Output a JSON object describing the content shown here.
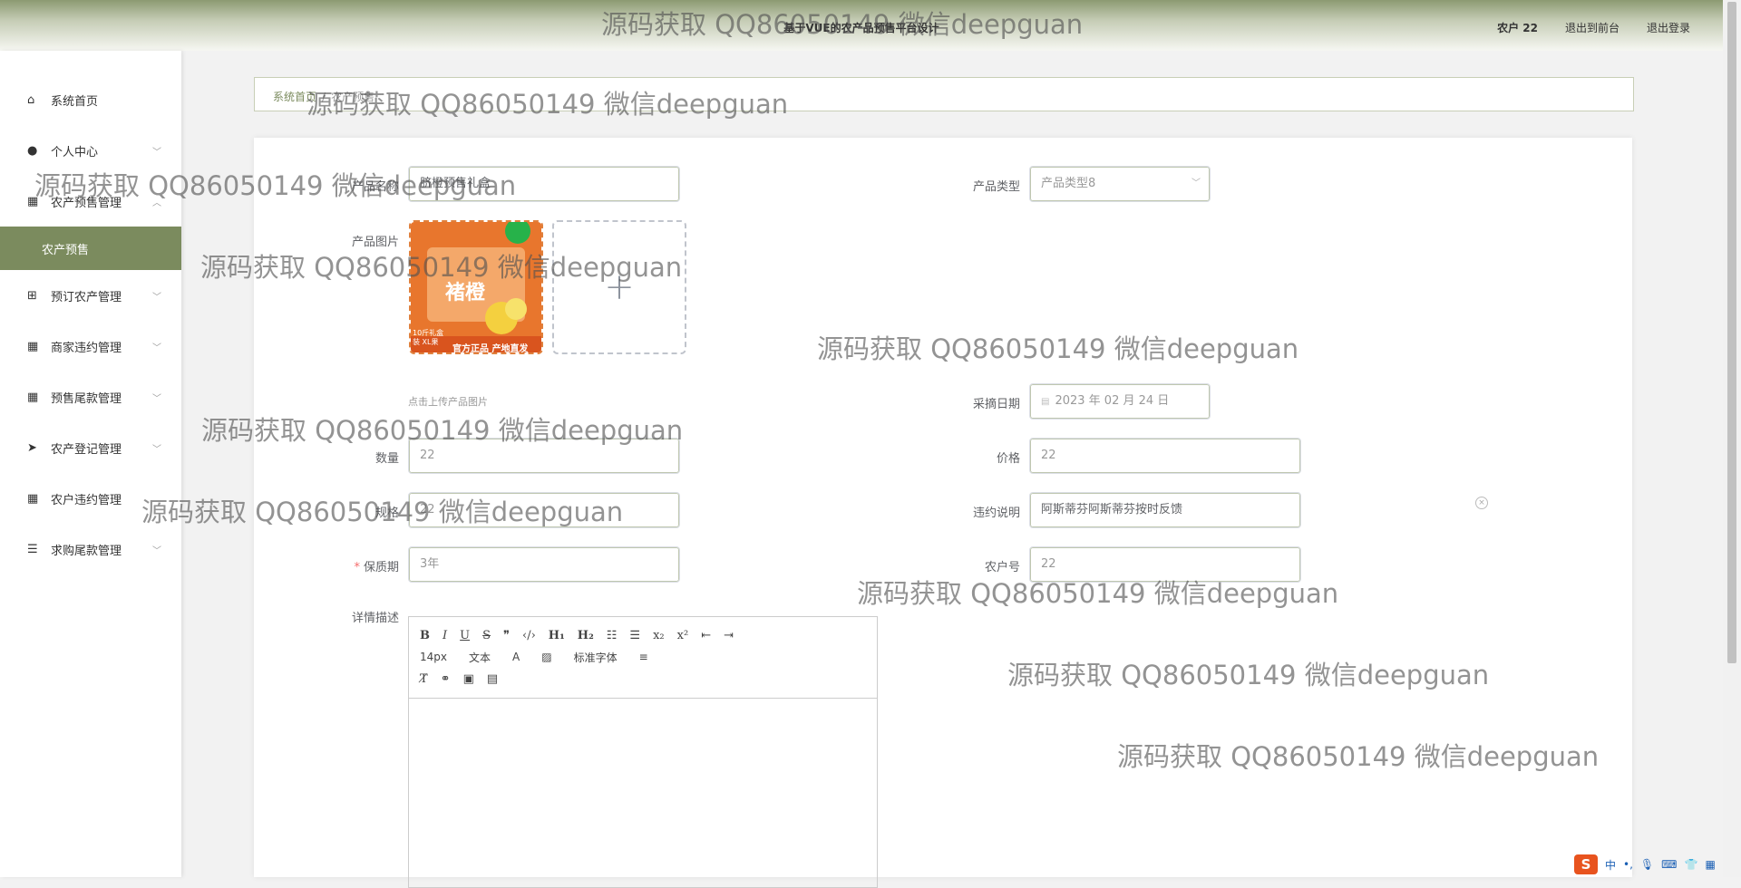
{
  "header": {
    "system_title": "基于VUE的农产品预售平台设计",
    "user": "农户 22",
    "back_to_front": "退出到前台",
    "logout": "退出登录"
  },
  "sidebar": {
    "items": [
      {
        "label": "系统首页",
        "icon": "home-icon"
      },
      {
        "label": "个人中心",
        "icon": "user-icon"
      },
      {
        "label": "农产预售管理",
        "icon": "grid-icon"
      },
      {
        "label": "农产预售",
        "icon": ""
      },
      {
        "label": "预订农产管理",
        "icon": "apps-icon"
      },
      {
        "label": "商家违约管理",
        "icon": "grid-icon"
      },
      {
        "label": "预售尾款管理",
        "icon": "grid-icon"
      },
      {
        "label": "农产登记管理",
        "icon": "send-icon"
      },
      {
        "label": "农户违约管理",
        "icon": "grid-icon"
      },
      {
        "label": "求购尾款管理",
        "icon": "list-icon"
      }
    ]
  },
  "breadcrumb": {
    "home": "系统首页",
    "current": "农产预售"
  },
  "form": {
    "product_name_label": "产品名称",
    "product_name_value": "脐橙预售礼盒",
    "product_type_label": "产品类型",
    "product_type_value": "产品类型8",
    "product_image_label": "产品图片",
    "upload_hint": "点击上传产品图片",
    "image_badge": "官方正品 产地直发",
    "image_title": "褚橙",
    "image_corner": "10斤礼盒装 XL果",
    "pick_date_label": "采摘日期",
    "pick_date_value": "2023 年 02 月 24 日",
    "quantity_label": "数量",
    "quantity_value": "22",
    "price_label": "价格",
    "price_value": "22",
    "spec_label": "规格",
    "spec_value": "22",
    "breach_label": "违约说明",
    "breach_value": "阿斯蒂芬阿斯蒂芬按时反馈",
    "shelf_life_label": "保质期",
    "shelf_life_value": "3年",
    "farmer_no_label": "农户号",
    "farmer_no_value": "22",
    "detail_label": "详情描述",
    "editor": {
      "font_size": "14px",
      "format": "文本",
      "font_family": "标准字体"
    }
  },
  "watermark_text": "源码获取 QQ86050149 微信deepguan",
  "ime": {
    "logo": "S",
    "lang": "中"
  }
}
